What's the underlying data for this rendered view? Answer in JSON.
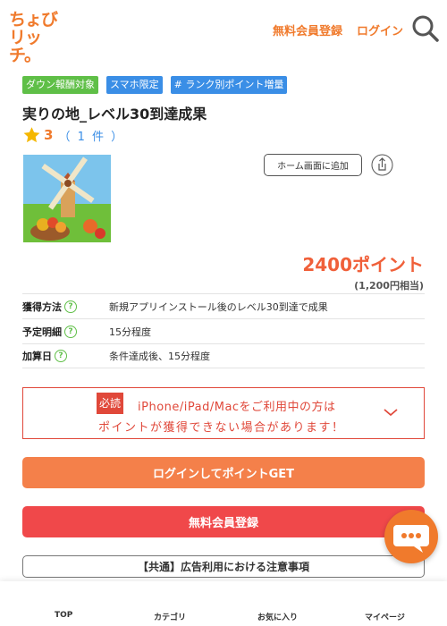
{
  "header": {
    "logo_line1": "ちょび",
    "logo_line2": "リッチ。",
    "register_link": "無料会員登録",
    "login_link": "ログイン",
    "search_icon": "search-icon"
  },
  "tags": [
    {
      "label": "ダウン報酬対象",
      "color": "#5fbf47"
    },
    {
      "label": "スマホ限定",
      "color": "#3a8ee6"
    },
    {
      "label": "# ランク別ポイント増量",
      "color": "#3a8ee6"
    }
  ],
  "offer": {
    "title": "実りの地_レベル30到達成果",
    "rating": "3",
    "review_count": "（ 1 件 ）",
    "home_button": "ホーム画面に追加",
    "points": "2400ポイント",
    "yen": "(1,200円相当)"
  },
  "info_rows": [
    {
      "key": "獲得方法",
      "value": "新規アプリインストール後のレベル30到達で成果"
    },
    {
      "key": "予定明細",
      "value": "15分程度"
    },
    {
      "key": "加算日",
      "value": "条件達成後、15分程度"
    }
  ],
  "notice": {
    "badge": "必読",
    "line1": "iPhone/iPad/Macをご利用中の方は",
    "line2": "ポイントが獲得できない場合があります！"
  },
  "buttons": {
    "login": "ログインしてポイントGET",
    "register": "無料会員登録",
    "caution": "【共通】広告利用における注意事項"
  },
  "tabbar": {
    "top": "TOP",
    "category": "カテゴリ",
    "favorites": "お気に入り",
    "mypage": "マイページ"
  },
  "colors": {
    "brand_orange": "#f07a2c",
    "alert_red": "#e0483a",
    "tag_green": "#5fbf47",
    "tag_blue": "#3a8ee6"
  }
}
